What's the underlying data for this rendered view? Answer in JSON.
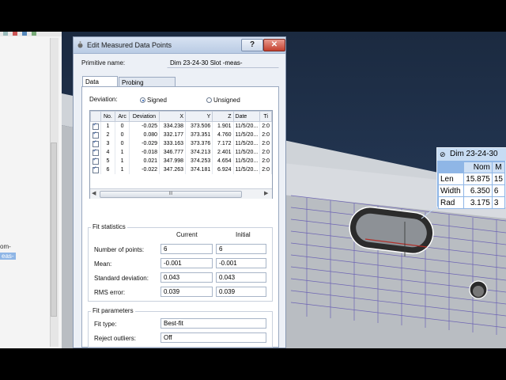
{
  "left_panel": {
    "lines": [
      "om-",
      "eas-"
    ]
  },
  "dialog": {
    "title": "Edit Measured Data Points",
    "help": "?",
    "close": "✕",
    "primitive_label": "Primitive name:",
    "primitive_value": "Dim 23-24-30 Slot -meas-",
    "tabs": [
      "Data points",
      "Probing parameters"
    ],
    "deviation_label": "Deviation:",
    "signed": "Signed",
    "unsigned": "Unsigned",
    "columns": [
      "No.",
      "Arc",
      "Deviation",
      "X",
      "Y",
      "Z",
      "Date",
      "Ti"
    ],
    "rows": [
      [
        "1",
        "0",
        "-0.025",
        "334.238",
        "373.506",
        "1.901",
        "11/5/20...",
        "2:0"
      ],
      [
        "2",
        "0",
        "0.080",
        "332.177",
        "373.351",
        "4.760",
        "11/5/20...",
        "2:0"
      ],
      [
        "3",
        "0",
        "-0.029",
        "333.163",
        "373.376",
        "7.172",
        "11/5/20...",
        "2:0"
      ],
      [
        "4",
        "1",
        "-0.018",
        "346.777",
        "374.213",
        "2.401",
        "11/5/20...",
        "2:0"
      ],
      [
        "5",
        "1",
        "0.021",
        "347.998",
        "374.253",
        "4.654",
        "11/5/20...",
        "2:0"
      ],
      [
        "6",
        "1",
        "-0.022",
        "347.263",
        "374.181",
        "6.924",
        "11/5/20...",
        "2:0"
      ]
    ],
    "scroll_grip": "III",
    "fit_stats": {
      "title": "Fit statistics",
      "col_current": "Current",
      "col_initial": "Initial",
      "rows": [
        {
          "label": "Number of points:",
          "current": "6",
          "initial": "6"
        },
        {
          "label": "Mean:",
          "current": "-0.001",
          "initial": "-0.001"
        },
        {
          "label": "Standard deviation:",
          "current": "0.043",
          "initial": "0.043"
        },
        {
          "label": "RMS error:",
          "current": "0.039",
          "initial": "0.039"
        }
      ]
    },
    "fit_params": {
      "title": "Fit parameters",
      "fit_type_label": "Fit type:",
      "fit_type_value": "Best-fit",
      "reject_label": "Reject outliers:",
      "reject_value": "Off"
    }
  },
  "dim_label": {
    "title": "Dim 23-24-30",
    "col_nom": "Nom",
    "col_m": "M",
    "rows": [
      {
        "name": "Len",
        "nom": "15.875",
        "m": "15"
      },
      {
        "name": "Width",
        "nom": "6.350",
        "m": "6"
      },
      {
        "name": "Rad",
        "nom": "3.175",
        "m": "3"
      }
    ]
  }
}
